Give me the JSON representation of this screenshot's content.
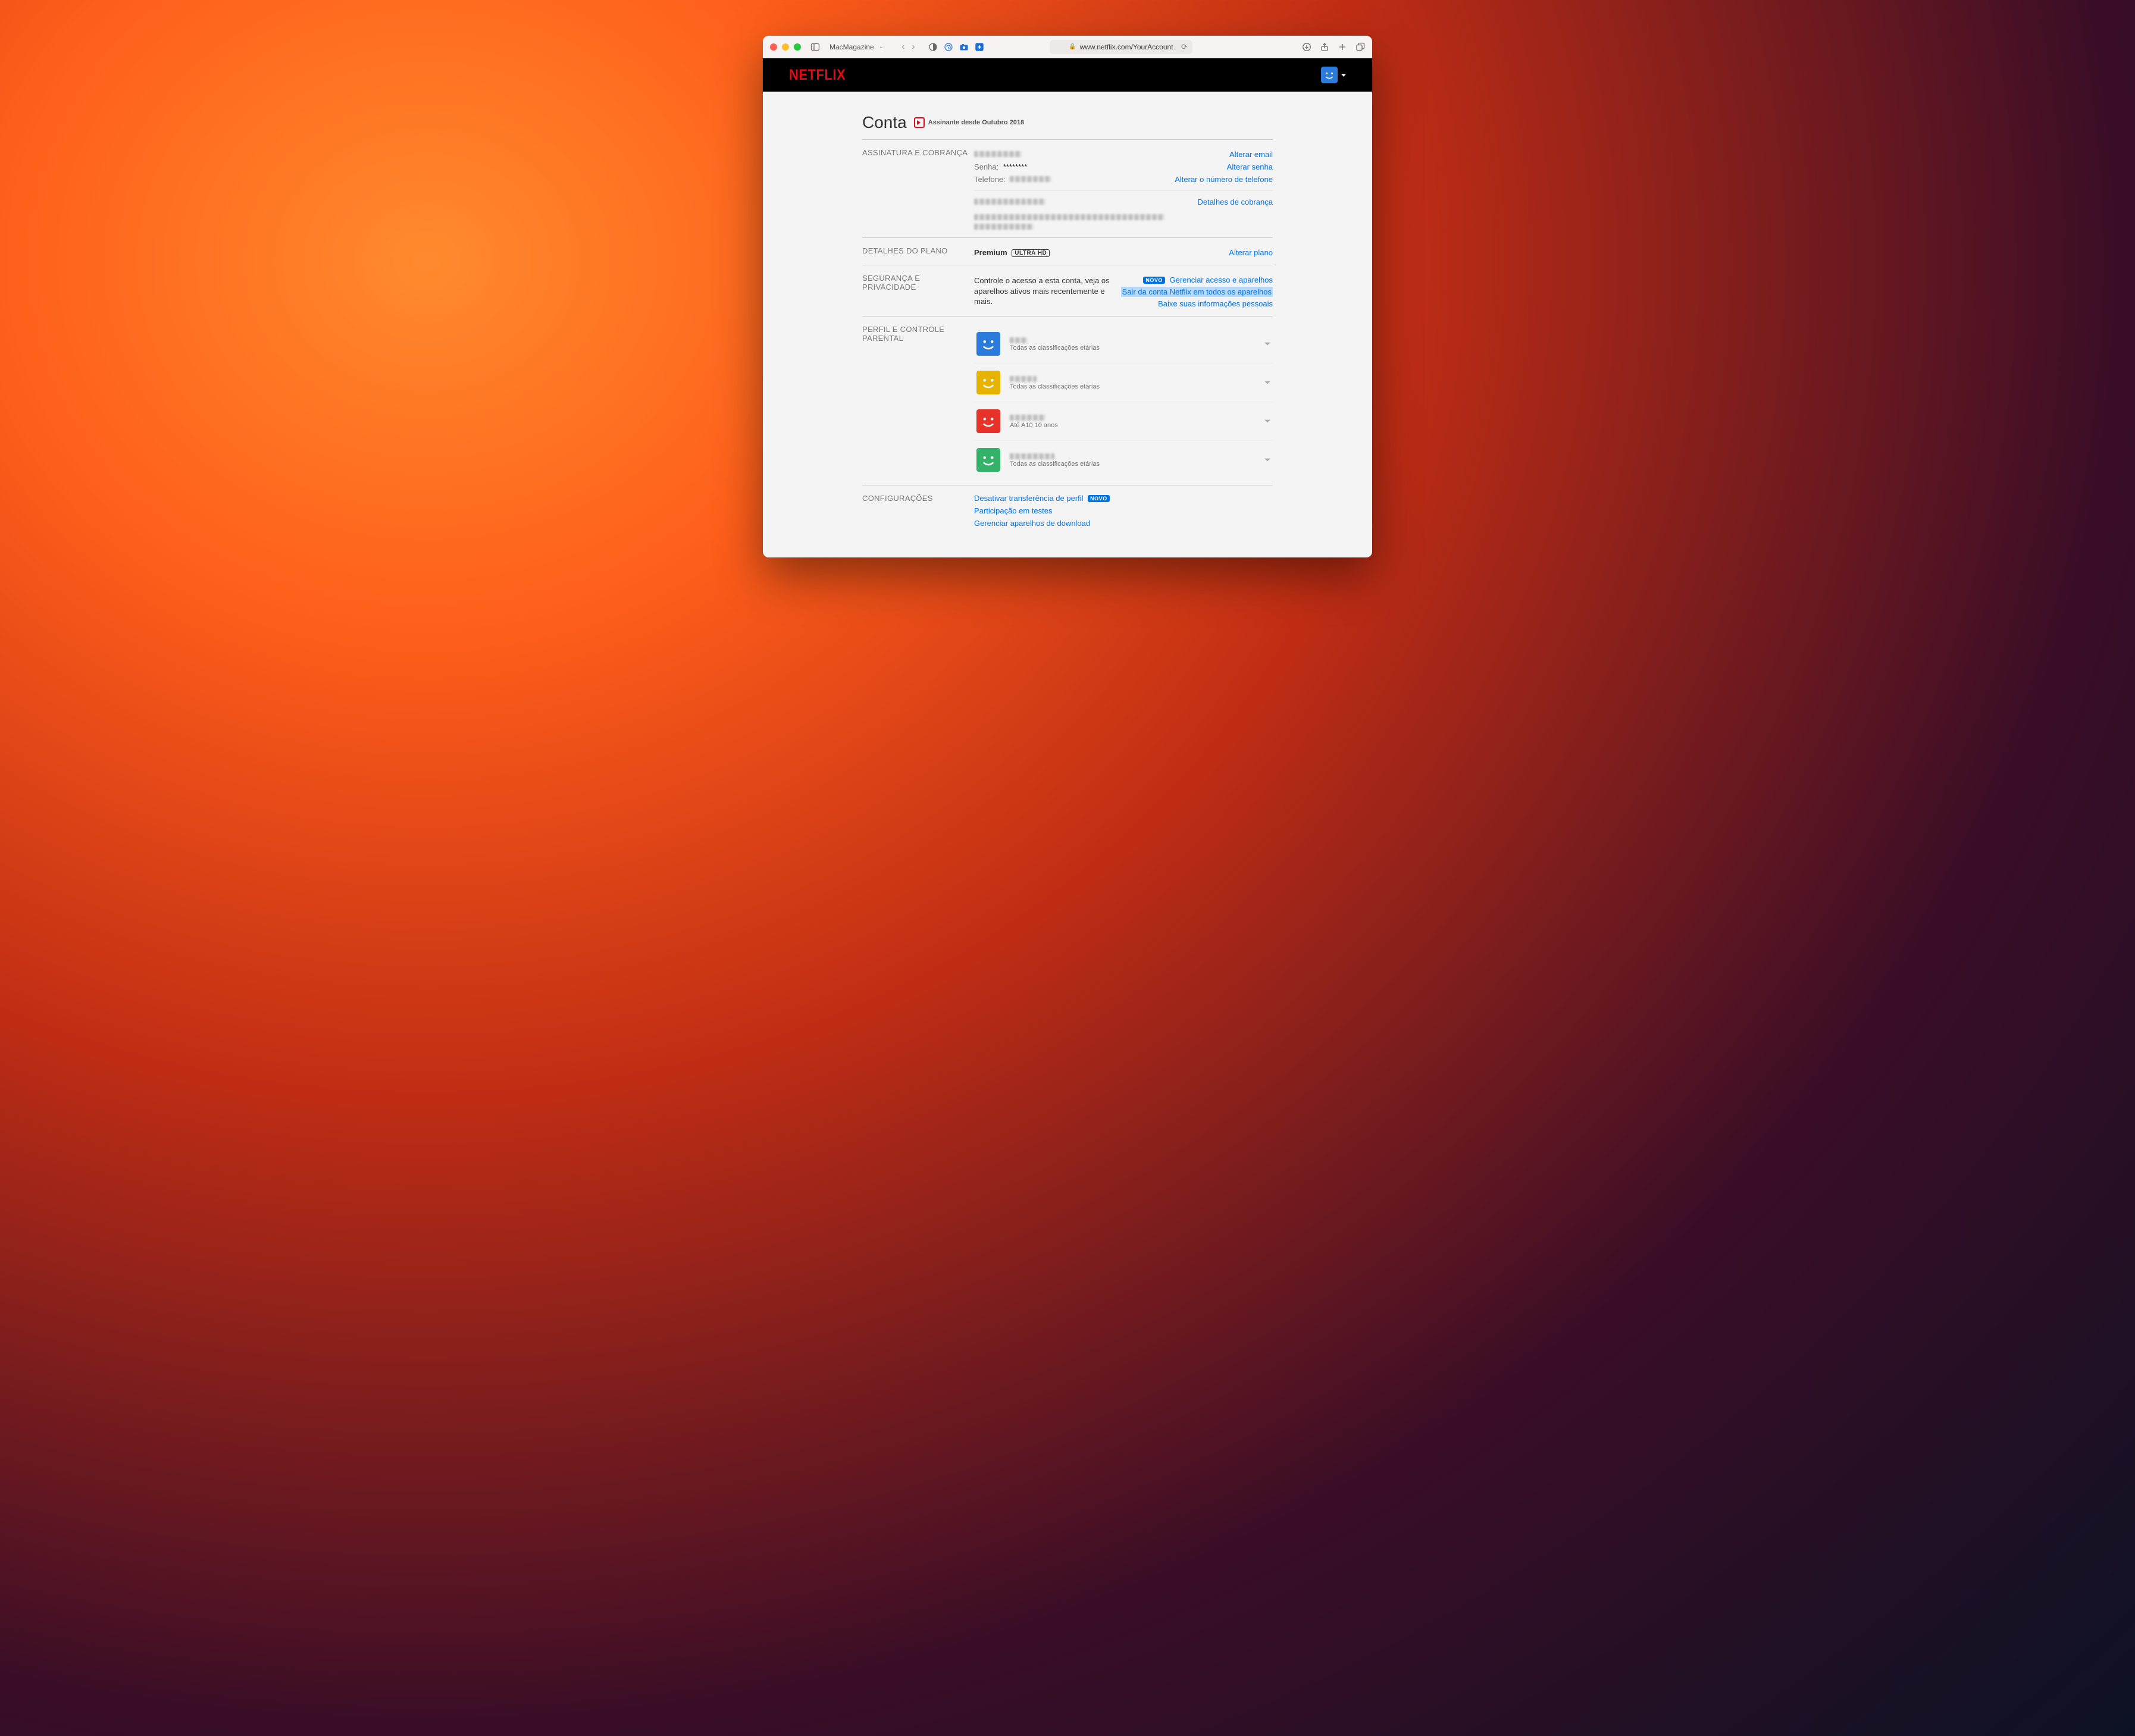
{
  "browser": {
    "tab_group": "MacMagazine",
    "url_display": "www.netflix.com/YourAccount"
  },
  "header": {
    "logo_text": "NETFLIX"
  },
  "page": {
    "title": "Conta",
    "member_since": "Assinante desde Outubro 2018"
  },
  "membership": {
    "label": "ASSINATURA E COBRANÇA",
    "password_label": "Senha:",
    "password_mask": "********",
    "phone_label": "Telefone:",
    "links": {
      "change_email": "Alterar email",
      "change_password": "Alterar senha",
      "change_phone": "Alterar o número de telefone",
      "billing_details": "Detalhes de cobrança"
    }
  },
  "plan": {
    "label": "DETALHES DO PLANO",
    "name": "Premium",
    "badge": "ULTRA HD",
    "link_change": "Alterar plano"
  },
  "security": {
    "label": "SEGURANÇA E PRIVACIDADE",
    "description": "Controle o acesso a esta conta, veja os aparelhos ativos mais recentemente e mais.",
    "novo_badge": "NOVO",
    "links": {
      "manage_devices": "Gerenciar acesso e aparelhos",
      "signout_all": "Sair da conta Netflix em todos os aparelhos",
      "download_info": "Baixe suas informações pessoais"
    }
  },
  "profiles_section": {
    "label": "PERFIL E CONTROLE PARENTAL"
  },
  "profiles": [
    {
      "color": "#2a7bdc",
      "maturity": "Todas as classificações etárias"
    },
    {
      "color": "#e6b400",
      "maturity": "Todas as classificações etárias"
    },
    {
      "color": "#e63228",
      "maturity": "Até A10  10 anos"
    },
    {
      "color": "#35b26a",
      "maturity": "Todas as classificações etárias"
    }
  ],
  "settings": {
    "label": "CONFIGURAÇÕES",
    "links": {
      "disable_transfer": "Desativar transferência de perfil",
      "novo_badge": "NOVO",
      "test_participation": "Participação em testes",
      "manage_downloads": "Gerenciar aparelhos de download"
    }
  }
}
